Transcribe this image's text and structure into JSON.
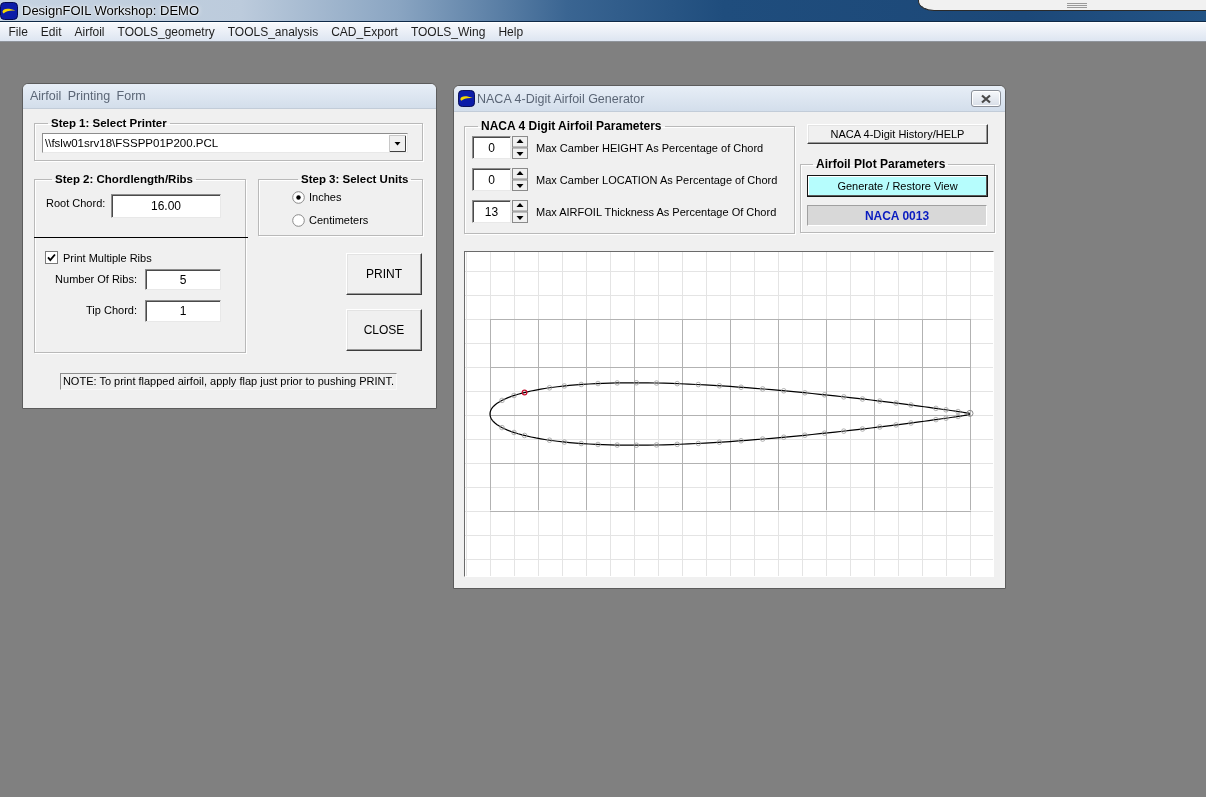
{
  "app_window": {
    "title": "DesignFOIL Workshop: DEMO"
  },
  "menu_bar": [
    "File",
    "Edit",
    "Airfoil",
    "TOOLS_geometry",
    "TOOLS_analysis",
    "CAD_Export",
    "TOOLS_Wing",
    "Help"
  ],
  "printing_form": {
    "title": "Airfoil Printing Form",
    "step1": {
      "title": "Step 1: Select Printer",
      "printer": "\\\\fslw01srv18\\FSSPP01P200.PCL"
    },
    "step2": {
      "title": "Step 2: Chordlength/Ribs",
      "root_chord_label": "Root Chord:",
      "root_chord": "16.00",
      "multiple_ribs": {
        "label": "Print Multiple Ribs",
        "checked": true
      },
      "number_of_ribs_label": "Number Of Ribs:",
      "number_of_ribs": "5",
      "tip_chord_label": "Tip Chord:",
      "tip_chord": "1"
    },
    "step3": {
      "title": "Step 3: Select Units",
      "units": [
        {
          "label": "Inches",
          "selected": true
        },
        {
          "label": "Centimeters",
          "selected": false
        }
      ]
    },
    "buttons": [
      "PRINT",
      "CLOSE"
    ],
    "note": "NOTE: To print flapped airfoil, apply flap just prior to pushing PRINT."
  },
  "naca_generator": {
    "title": "NACA 4-Digit Airfoil Generator",
    "parameters": {
      "title": "NACA 4 Digit Airfoil Parameters",
      "rows": [
        {
          "value": "0",
          "label": "Max Camber HEIGHT As Percentage of Chord"
        },
        {
          "value": "0",
          "label": "Max Camber LOCATION As Percentage of Chord"
        },
        {
          "value": "13",
          "label": "Max AIRFOIL Thickness As Percentage Of Chord"
        }
      ]
    },
    "help_button": "NACA 4-Digit History/HELP",
    "plot_parameters": {
      "title": "Airfoil Plot Parameters",
      "generate_button": "Generate / Restore View",
      "airfoil_name": "NACA 0013"
    }
  }
}
